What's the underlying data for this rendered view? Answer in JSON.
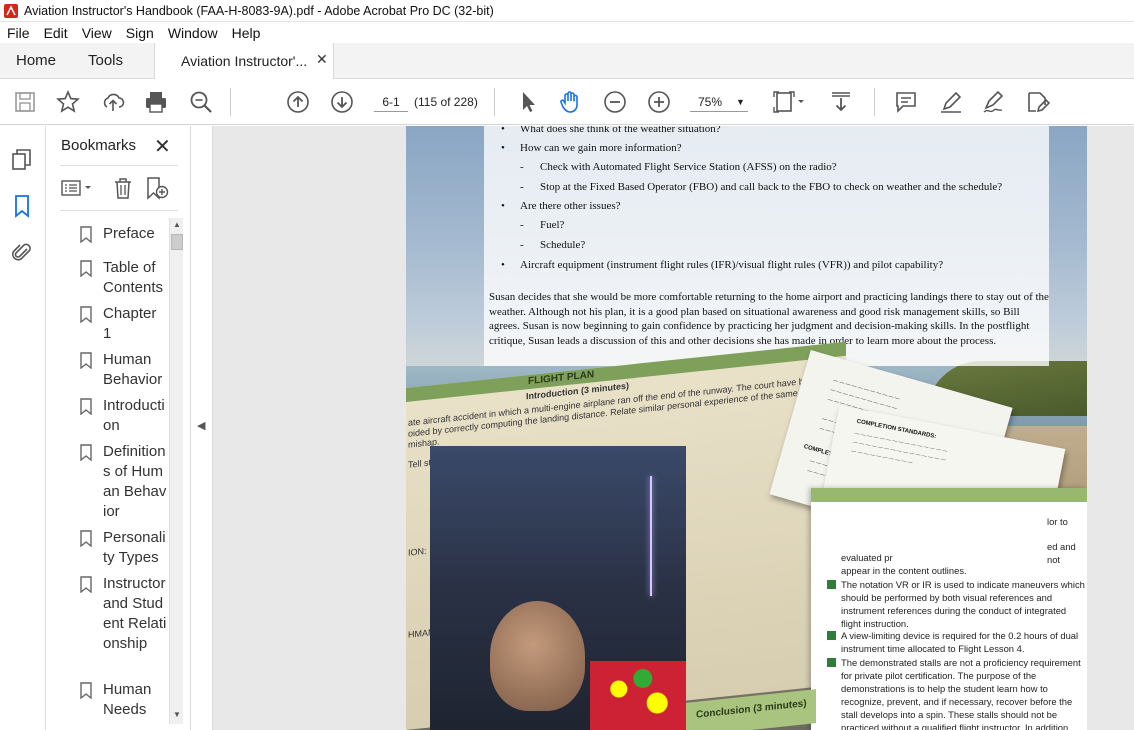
{
  "window": {
    "title": "Aviation Instructor's Handbook (FAA-H-8083-9A).pdf - Adobe Acrobat Pro DC (32-bit)"
  },
  "menu": [
    "File",
    "Edit",
    "View",
    "Sign",
    "Window",
    "Help"
  ],
  "tabs": {
    "home": "Home",
    "tools": "Tools",
    "document": "Aviation Instructor'..."
  },
  "toolbar": {
    "page_value": "6-1",
    "page_count": "(115 of 228)",
    "zoom": "75%",
    "icons": [
      "save-icon",
      "bookmark-star-icon",
      "upload-icon",
      "print-icon",
      "search-zoom-icon",
      "page-up-icon",
      "page-down-icon",
      "select-arrow-icon",
      "hand-tool-icon",
      "zoom-out-icon",
      "zoom-in-icon",
      "fit-page-icon",
      "scroll-mode-icon",
      "comment-icon",
      "highlight-icon",
      "sign-icon",
      "edit-pdf-icon"
    ]
  },
  "bookmarks": {
    "title": "Bookmarks",
    "items": [
      {
        "label": "Preface"
      },
      {
        "label": "Table of Contents"
      },
      {
        "label": "Chapter 1"
      },
      {
        "label": "Human Behavior"
      },
      {
        "label": "Introduction"
      },
      {
        "label": "Definitions of Human Behavior"
      },
      {
        "label": "Personality Types"
      },
      {
        "label": "Instructor and Student Relationship"
      },
      {
        "label": "Human Needs"
      }
    ]
  },
  "document": {
    "bullets": [
      {
        "level": 1,
        "text": "What does she think of the weather situation?"
      },
      {
        "level": 1,
        "text": "How can we gain more information?"
      },
      {
        "level": 2,
        "text": "Check with Automated Flight Service Station (AFSS) on the radio?"
      },
      {
        "level": 2,
        "text": "Stop at the Fixed Based Operator (FBO) and call back to the FBO to check on weather and the schedule?"
      },
      {
        "level": 1,
        "text": "Are there other issues?"
      },
      {
        "level": 2,
        "text": "Fuel?"
      },
      {
        "level": 2,
        "text": "Schedule?"
      },
      {
        "level": 1,
        "text": "Aircraft equipment (instrument flight rules (IFR)/visual flight rules (VFR)) and pilot capability?"
      }
    ],
    "paragraph": "Susan decides that she would be more comfortable returning to the home airport and practicing landings there to stay out of the weather. Although not his plan, it is a good plan based on situational awareness and good risk management skills, so Bill agrees. Susan is now beginning to gain confidence by practicing her judgment and decision-making skills. In the postflight critique, Susan leads a discussion of this and other decisions she has made in order to learn more about the process.",
    "flight_plan": {
      "heading": "FLIGHT PLAN",
      "intro": "Introduction (3 minutes)",
      "lines": [
        "ate aircraft accident in which a multi-engine airplane ran off the end of the runway. The court have been",
        "oided by correctly computing the landing distance. Relate similar personal experience of the same type",
        "mishap.",
        "Tell st",
        "ION:",
        "HMAN"
      ]
    },
    "papers": {
      "completion1": "COMPLETION STANDARDS:",
      "completion2": "COMPLETION STANDARDS:"
    },
    "card": {
      "partial": [
        "lor to",
        "ed and",
        "not",
        "evaluated pr",
        "appear in the content outlines."
      ],
      "items": [
        "The notation VR or IR is used to indicate maneuvers which should be performed by both visual references and instrument references during the conduct of integrated flight instruction.",
        "A view-limiting device is required for the 0.2 hours of dual instrument time allocated to Flight Lesson 4.",
        "The demonstrated stalls are not a proficiency requirement for private pilot certification. The purpose of the demonstrations is to help the student learn how to recognize, prevent, and if necessary, recover before the stall develops into a spin. These stalls should not be practiced without a qualified flight instructor. In addition,"
      ]
    },
    "conclusion": "Conclusion (3 minutes)"
  }
}
